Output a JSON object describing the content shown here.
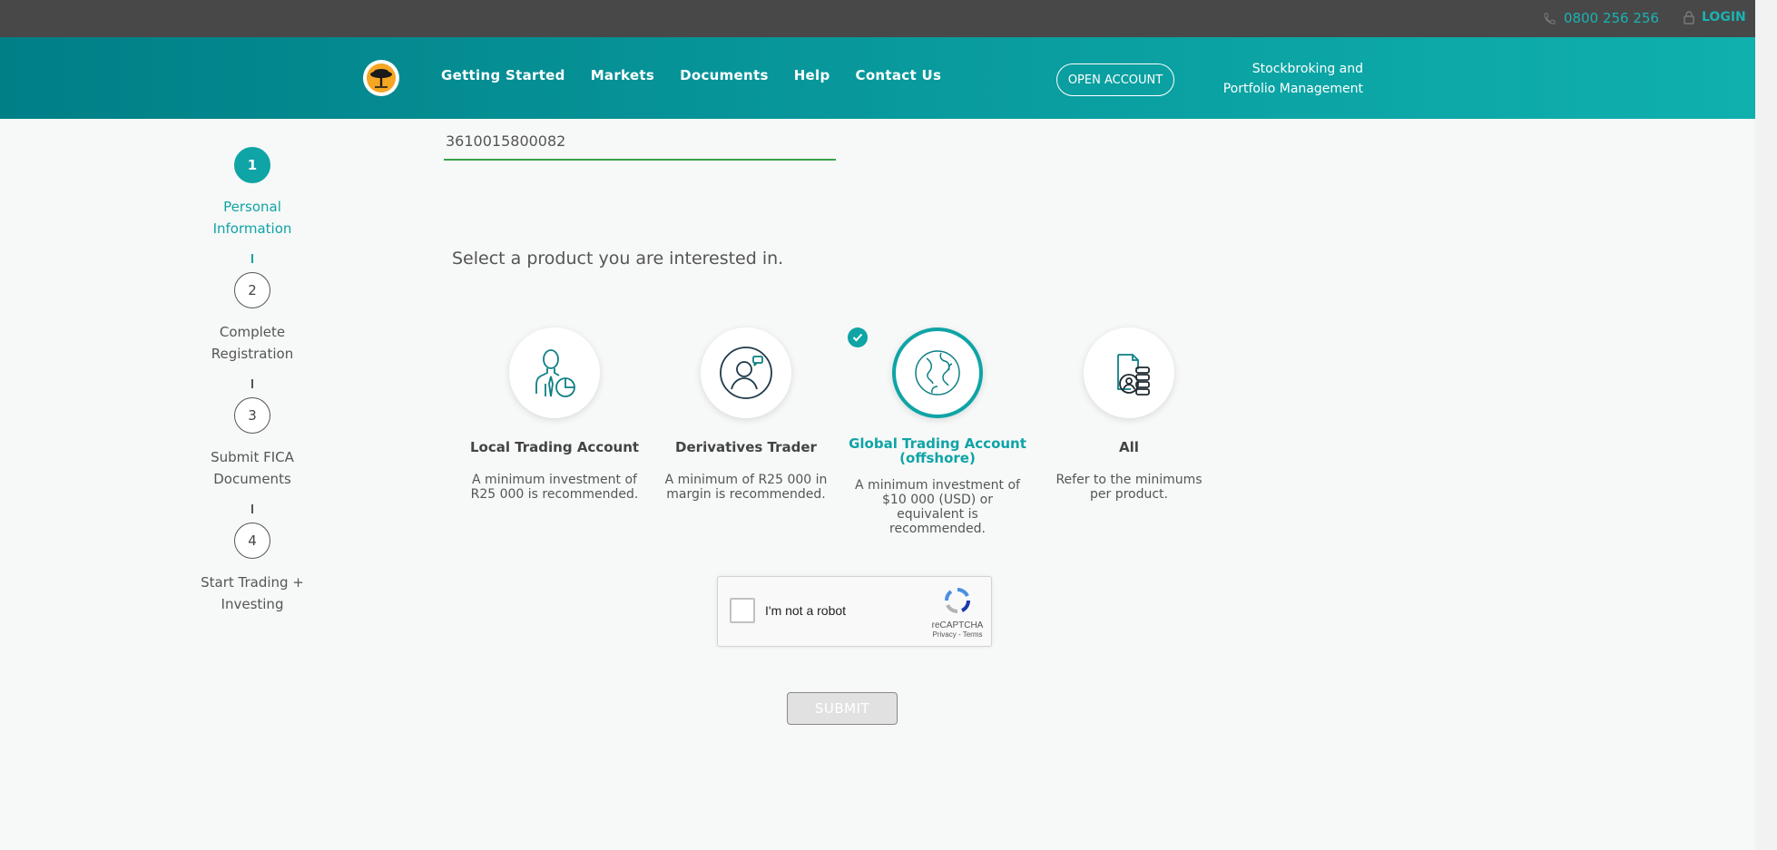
{
  "topbar": {
    "phone": "0800 256 256",
    "login": "LOGIN"
  },
  "header": {
    "nav": [
      "Getting Started",
      "Markets",
      "Documents",
      "Help",
      "Contact Us"
    ],
    "open_account": "OPEN ACCOUNT",
    "tagline_line1": "Stockbroking and",
    "tagline_line2": "Portfolio Management"
  },
  "stepper": {
    "steps": [
      {
        "number": "1",
        "label_line1": "Personal",
        "label_line2": "Information",
        "active": true
      },
      {
        "number": "2",
        "label_line1": "Complete",
        "label_line2": "Registration",
        "active": false
      },
      {
        "number": "3",
        "label_line1": "Submit FICA",
        "label_line2": "Documents",
        "active": false
      },
      {
        "number": "4",
        "label_line1": "Start Trading +",
        "label_line2": "Investing",
        "active": false
      }
    ]
  },
  "form": {
    "id_number": "3610015800082",
    "prompt": "Select a product you are interested in."
  },
  "products": [
    {
      "title": "Local Trading Account",
      "title_line2": "",
      "desc": "A minimum investment of R25 000 is recommended.",
      "icon": "person-chart-icon",
      "selected": false
    },
    {
      "title": "Derivatives Trader",
      "title_line2": "",
      "desc": "A minimum of R25 000 in margin is recommended.",
      "icon": "trader-headset-icon",
      "selected": false
    },
    {
      "title": "Global Trading Account",
      "title_line2": "(offshore)",
      "desc": "A minimum investment of $10 000 (USD) or equivalent is recommended.",
      "icon": "globe-icon",
      "selected": true
    },
    {
      "title": "All",
      "title_line2": "",
      "desc": "Refer to the minimums per product.",
      "icon": "documents-coins-icon",
      "selected": false
    }
  ],
  "captcha": {
    "label": "I'm not a robot",
    "brand": "reCAPTCHA",
    "links": "Privacy - Terms"
  },
  "submit": "SUBMIT",
  "colors": {
    "teal": "#0fa4a6",
    "topbar": "#484848",
    "underline": "#3aa24a"
  }
}
